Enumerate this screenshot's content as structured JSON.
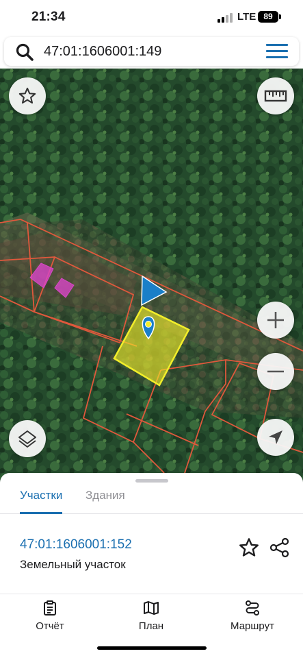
{
  "status_bar": {
    "time": "21:34",
    "network": "LTE",
    "battery": "89"
  },
  "search": {
    "query": "47:01:1606001:149",
    "icon": "search-icon",
    "menu_icon": "hamburger-menu-icon"
  },
  "map": {
    "controls": {
      "favorite": "star-icon",
      "ruler": "ruler-icon",
      "zoom_in": "plus-icon",
      "zoom_out": "minus-icon",
      "layers": "layers-icon",
      "locate": "navigation-arrow-icon"
    },
    "colors": {
      "parcel_border": "#e0583c",
      "selected_parcel": "#f2ee2a",
      "building": "#d946c8",
      "marker": "#1a7fc8"
    }
  },
  "sheet": {
    "tabs": [
      {
        "label": "Участки",
        "active": true
      },
      {
        "label": "Здания",
        "active": false
      }
    ],
    "result": {
      "cadastral_number": "47:01:1606001:152",
      "type": "Земельный участок"
    }
  },
  "bottom_nav": [
    {
      "label": "Отчёт",
      "icon": "report-clipboard-icon"
    },
    {
      "label": "План",
      "icon": "map-icon"
    },
    {
      "label": "Маршрут",
      "icon": "route-icon"
    }
  ],
  "colors": {
    "accent": "#1a6fb0"
  }
}
